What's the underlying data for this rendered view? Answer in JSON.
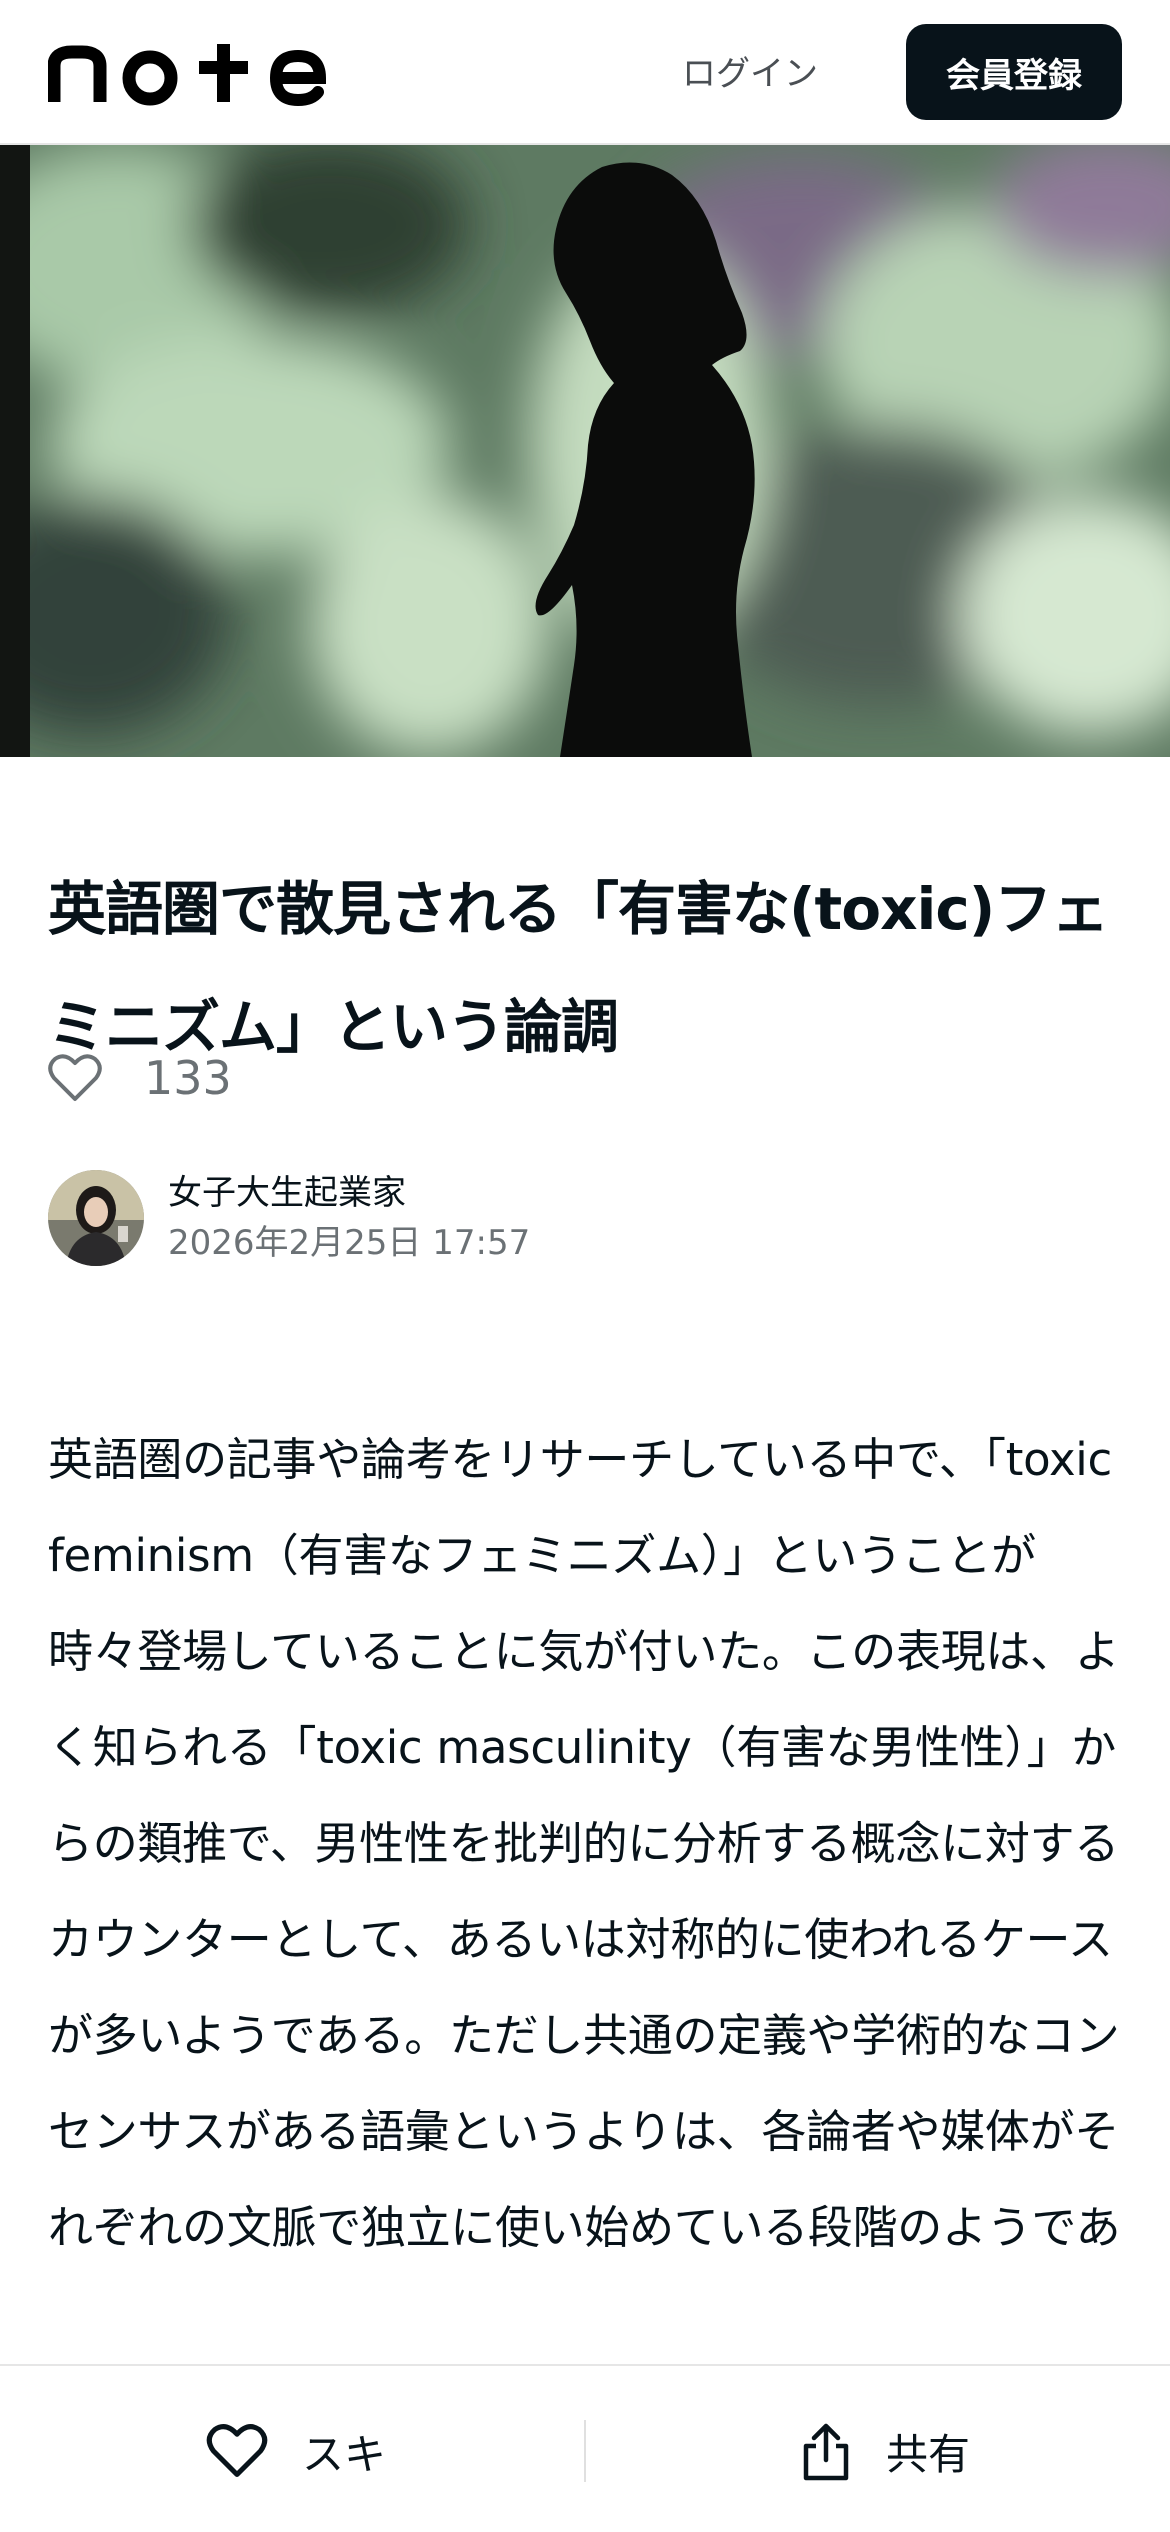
{
  "header": {
    "logo_text": "note",
    "login_label": "ログイン",
    "signup_label": "会員登録"
  },
  "hero": {
    "icon": "silhouette-photo"
  },
  "article": {
    "title": "英語圏で散見される「有害な(toxic)フェミニズム」という論調",
    "like_count": "133",
    "author_name": "女子大生起業家",
    "date": "2026年2月25日 17:57",
    "body": "英語圏の記事や論考をリサーチしている中で、「toxic feminism（有害なフェミニズム）」ということが時々登場していることに気が付いた。この表現は、よく知られる「toxic masculinity（有害な男性性）」からの類推で、男性性を批判的に分析する概念に対するカウンターとして、あるいは対称的に使われるケースが多いようである。ただし共通の定義や学術的なコンセンサスがある語彙というよりは、各論者や媒体がそれぞれの文脈で独立に使い始めている段階のようであ"
  },
  "bottom_bar": {
    "like_label": "スキ",
    "share_label": "共有"
  },
  "colors": {
    "brand_dark": "#08131a",
    "muted": "#6b7175"
  }
}
